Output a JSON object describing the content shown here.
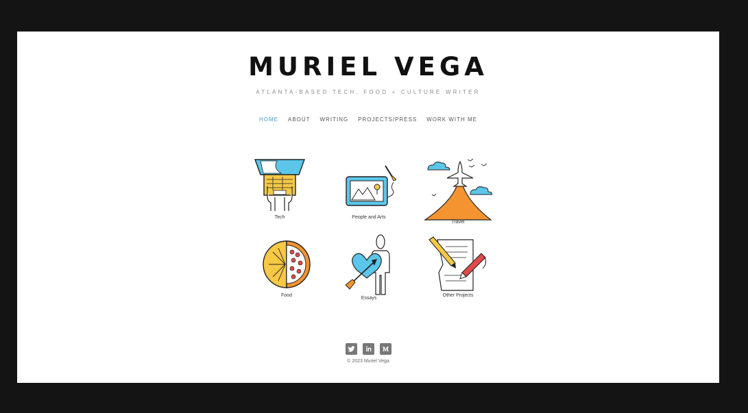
{
  "site": {
    "title": "MURIEL VEGA",
    "tagline": "ATLANTA-BASED TECH, FOOD + CULTURE WRITER"
  },
  "nav": [
    {
      "label": "HOME",
      "active": true
    },
    {
      "label": "ABOUT"
    },
    {
      "label": "WRITING"
    },
    {
      "label": "PROJECTS/PRESS"
    },
    {
      "label": "WORK WITH ME"
    }
  ],
  "categories": [
    {
      "label": "Tech",
      "icon": "laptop-icon"
    },
    {
      "label": "People and Arts",
      "icon": "picture-frame-icon"
    },
    {
      "label": "Travel",
      "icon": "airplane-icon"
    },
    {
      "label": "Food",
      "icon": "pie-pizza-icon"
    },
    {
      "label": "Essays",
      "icon": "heart-person-icon"
    },
    {
      "label": "Other Projects",
      "icon": "paper-pen-icon"
    }
  ],
  "social": [
    {
      "icon": "twitter-icon"
    },
    {
      "icon": "linkedin-icon"
    },
    {
      "icon": "medium-icon"
    }
  ],
  "footer": {
    "copyright": "© 2023 Muriel Vega"
  },
  "colors": {
    "accent": "#3d9fc6",
    "yellow": "#f6c945",
    "blue": "#5cc6ea",
    "orange": "#f39431",
    "red": "#e04a4a"
  }
}
